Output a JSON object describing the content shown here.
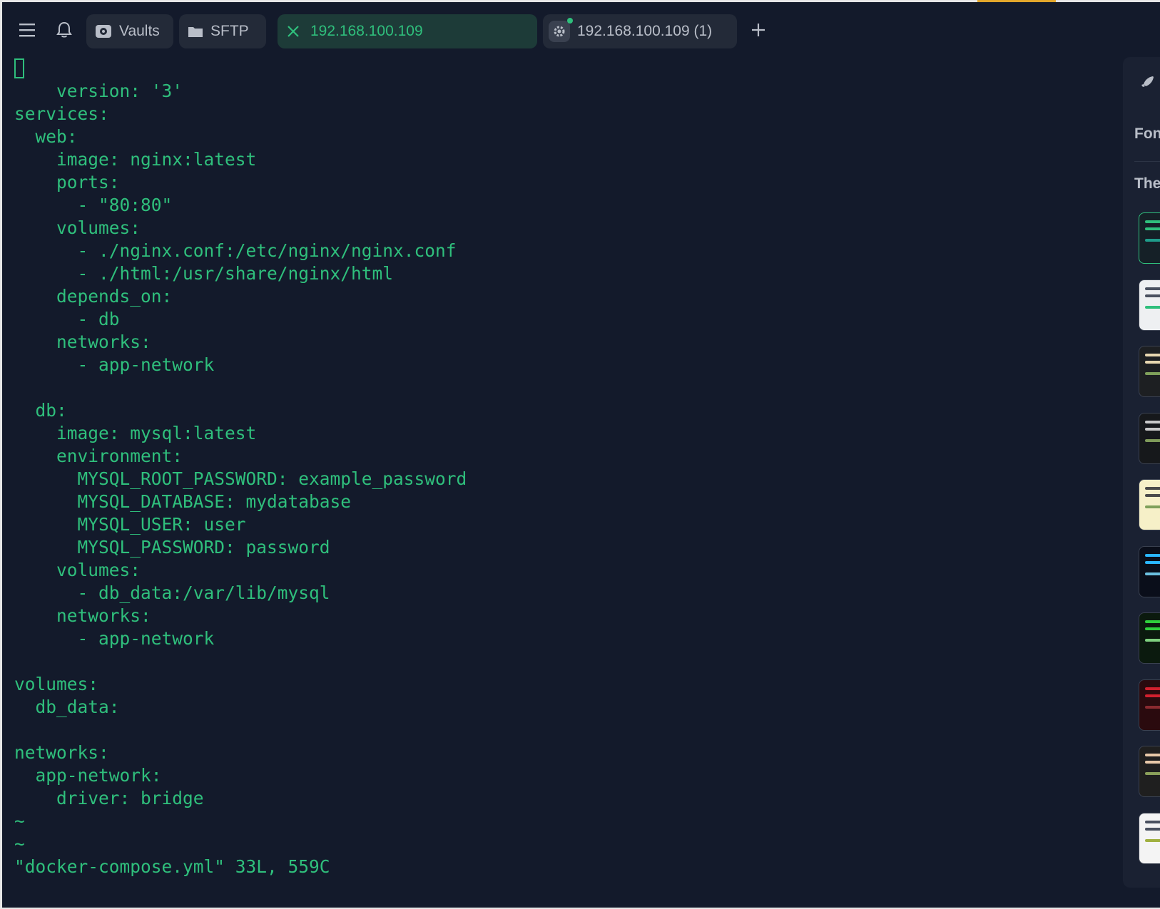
{
  "tabs": {
    "vaults": "Vaults",
    "sftp": "SFTP",
    "active_host": "192.168.100.109",
    "second_host": "192.168.100.109 (1)"
  },
  "editor": {
    "first_line_rest": "ersion: '3'",
    "first_char": "v",
    "lines": [
      "",
      "services:",
      "  web:",
      "    image: nginx:latest",
      "    ports:",
      "      - \"80:80\"",
      "    volumes:",
      "      - ./nginx.conf:/etc/nginx/nginx.conf",
      "      - ./html:/usr/share/nginx/html",
      "    depends_on:",
      "      - db",
      "    networks:",
      "      - app-network",
      "",
      "  db:",
      "    image: mysql:latest",
      "    environment:",
      "      MYSQL_ROOT_PASSWORD: example_password",
      "      MYSQL_DATABASE: mydatabase",
      "      MYSQL_USER: user",
      "      MYSQL_PASSWORD: password",
      "    volumes:",
      "      - db_data:/var/lib/mysql",
      "    networks:",
      "      - app-network",
      "",
      "volumes:",
      "  db_data:",
      "",
      "networks:",
      "  app-network:",
      "    driver: bridge",
      "~",
      "~",
      "\"docker-compose.yml\" 33L, 559C"
    ]
  },
  "panel": {
    "font_label": "Fon",
    "theme_label": "The",
    "themes": [
      {
        "bg": "#152027",
        "bars": [
          "#2fbf7c",
          "#2fbf7c",
          "#1f9c8a"
        ]
      },
      {
        "bg": "#eef0f2",
        "bars": [
          "#4a5160",
          "#4a5160",
          "#2fbf7c"
        ]
      },
      {
        "bg": "#1d1f22",
        "bars": [
          "#e8d7b0",
          "#e8d7b0",
          "#7fa05a"
        ]
      },
      {
        "bg": "#16181b",
        "bars": [
          "#c8c8c8",
          "#c8c8c8",
          "#7f9a5a"
        ]
      },
      {
        "bg": "#f6f0c8",
        "bars": [
          "#4a4a4a",
          "#4a4a4a",
          "#7fa05a"
        ]
      },
      {
        "bg": "#0a0e1a",
        "bars": [
          "#2ab6ff",
          "#2ab6ff",
          "#6cc0e0"
        ]
      },
      {
        "bg": "#0b1a0e",
        "bars": [
          "#2fcf3c",
          "#2fcf3c",
          "#7fd07f"
        ]
      },
      {
        "bg": "#2a0a0e",
        "bars": [
          "#d2202e",
          "#d2202e",
          "#8a2a30"
        ]
      },
      {
        "bg": "#1f1f1f",
        "bars": [
          "#e8c8a8",
          "#e8c8a8",
          "#8aa05a"
        ]
      },
      {
        "bg": "#f4f4f4",
        "bars": [
          "#4a5160",
          "#4a5160",
          "#a0b040"
        ]
      }
    ]
  }
}
